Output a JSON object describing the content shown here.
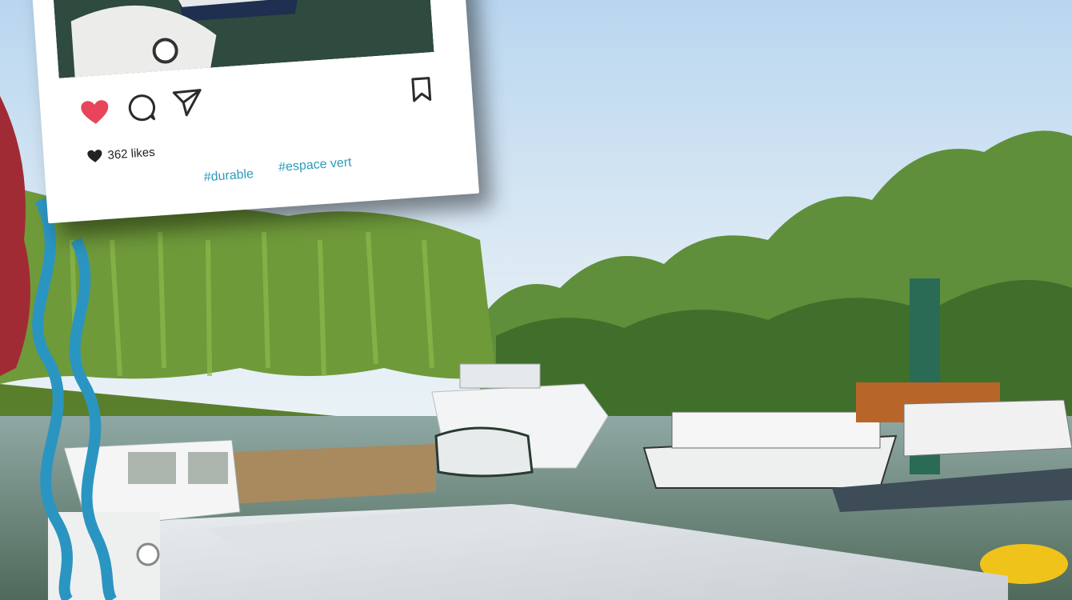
{
  "post": {
    "likes_text": "362 likes",
    "hashtags": [
      "#durable",
      "#espace vert"
    ],
    "icons": {
      "like": "heart-icon",
      "comment": "comment-bubble-icon",
      "share": "paper-plane-icon",
      "save": "bookmark-icon",
      "likes_count": "small-heart-icon"
    },
    "colors": {
      "heart": "#e8445a",
      "hashtag": "#2a9bbb",
      "wave": "#2b95c1"
    }
  }
}
